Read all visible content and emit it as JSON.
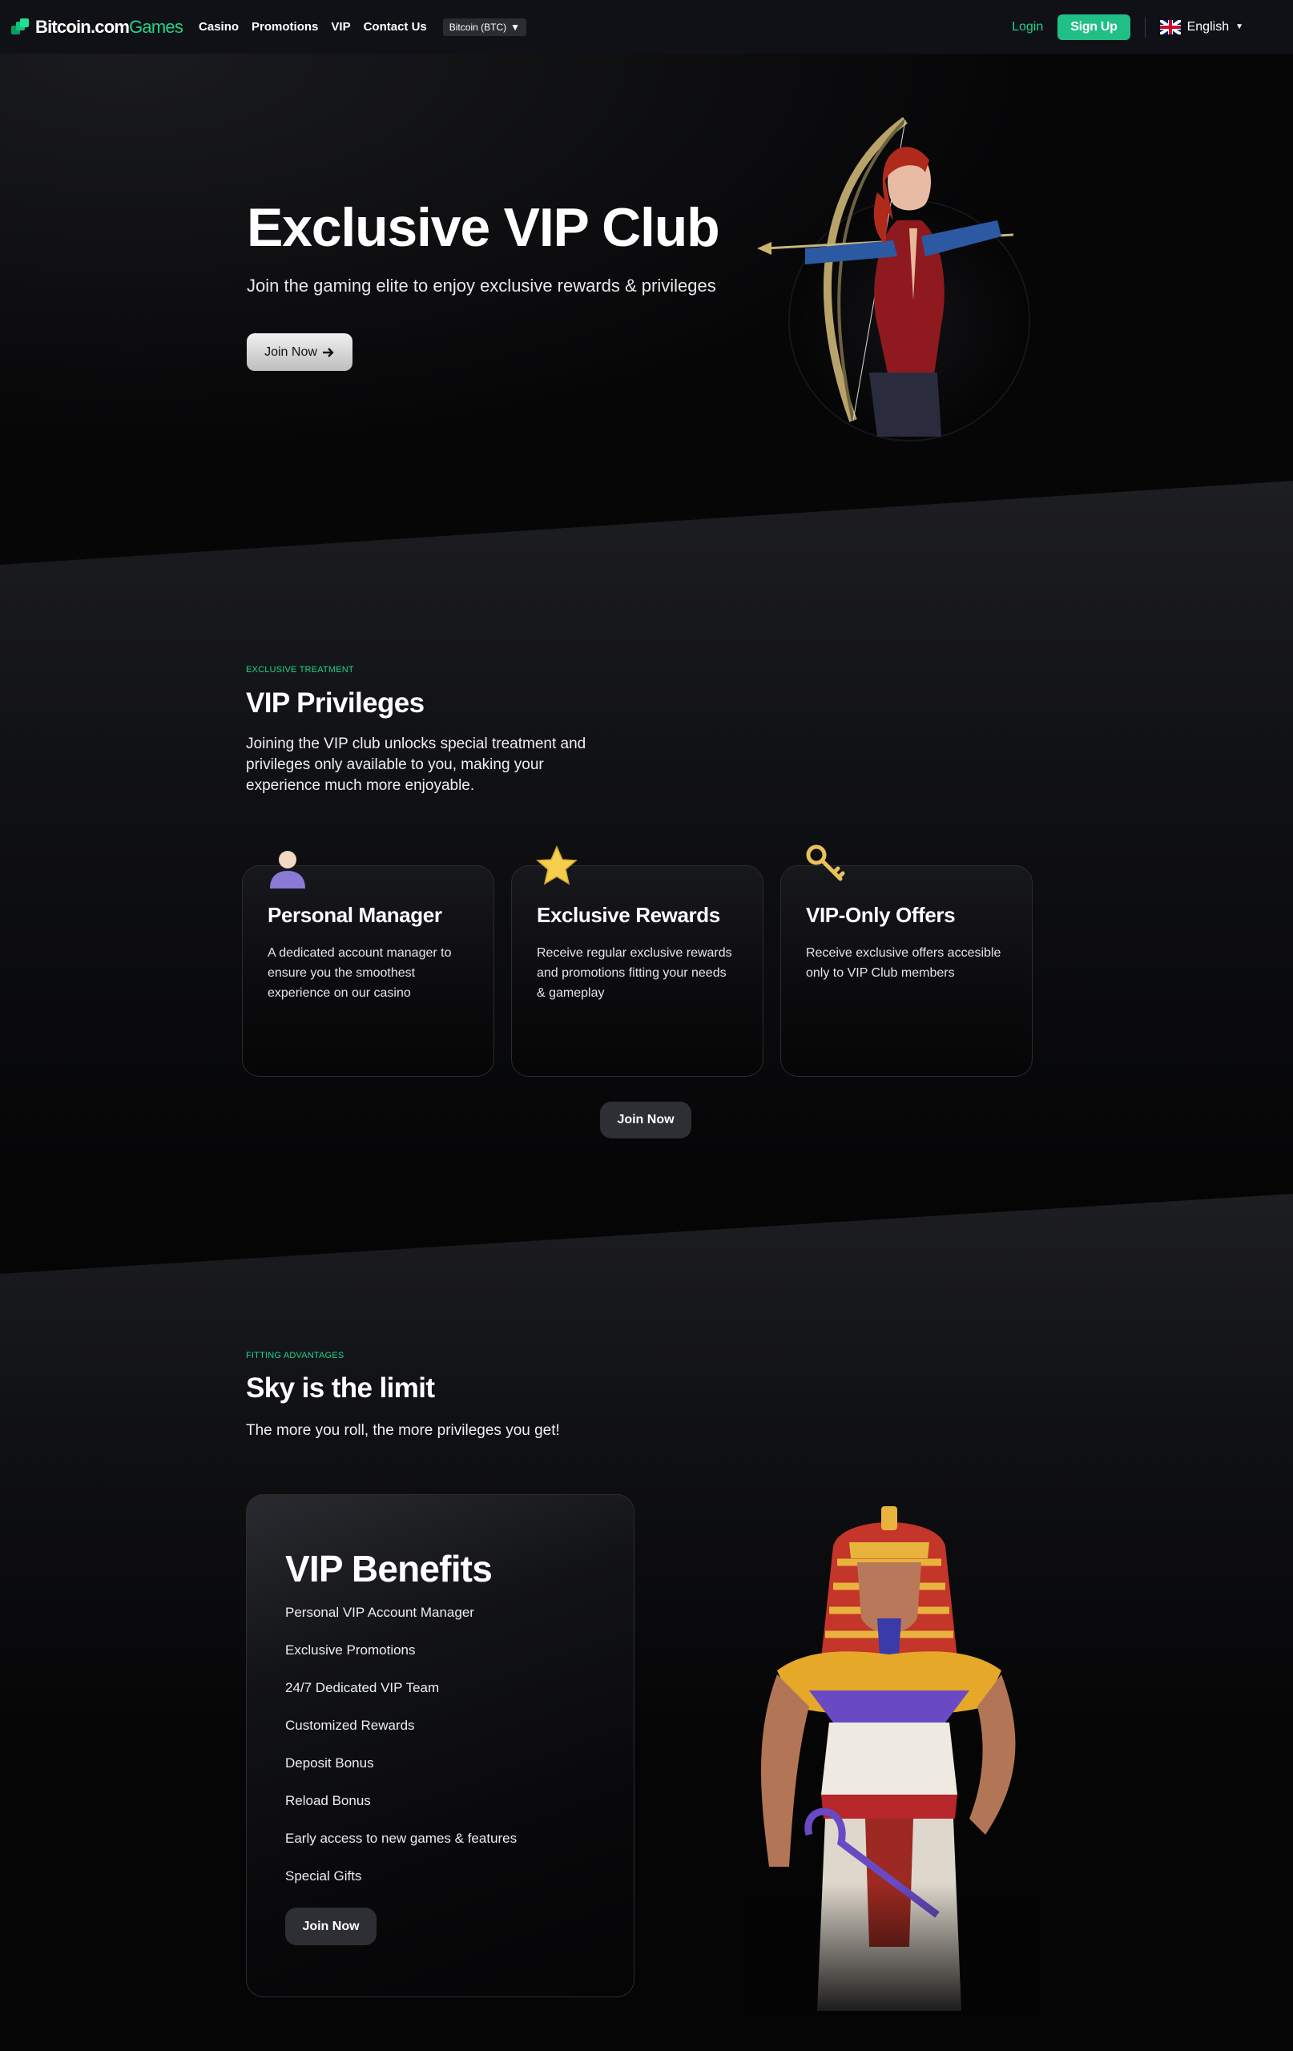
{
  "nav": {
    "logo_main": "Bitcoin.com",
    "logo_accent": "Games",
    "links": [
      "Casino",
      "Promotions",
      "VIP",
      "Contact Us"
    ],
    "currency": "Bitcoin (BTC)",
    "login": "Login",
    "signup": "Sign Up",
    "language": "English"
  },
  "hero": {
    "title": "Exclusive VIP Club",
    "subtitle": "Join the gaming elite to enjoy exclusive rewards & privileges",
    "button": "Join Now"
  },
  "privileges": {
    "eyebrow": "EXCLUSIVE TREATMENT",
    "title": "VIP Privileges",
    "text": "Joining the VIP club unlocks special treatment and privileges only available to you, making your experience much more enjoyable.",
    "cards": [
      {
        "title": "Personal Manager",
        "text": "A dedicated account manager to ensure you the smoothest experience on our casino",
        "icon": "person-icon"
      },
      {
        "title": "Exclusive Rewards",
        "text": "Receive regular exclusive rewards and promotions fitting your needs & gameplay",
        "icon": "star-icon"
      },
      {
        "title": "VIP-Only Offers",
        "text": "Receive exclusive offers accesible only to VIP Club members",
        "icon": "key-icon"
      }
    ],
    "button": "Join Now"
  },
  "advantages": {
    "eyebrow": "FITTING ADVANTAGES",
    "title": "Sky is the limit",
    "text": "The more you roll, the more privileges you get!",
    "benefits_title": "VIP Benefits",
    "benefits": [
      "Personal VIP Account Manager",
      "Exclusive Promotions",
      "24/7 Dedicated VIP Team",
      "Customized Rewards",
      "Deposit Bonus",
      "Reload Bonus",
      "Early access to new games & features",
      "Special Gifts"
    ],
    "button": "Join Now"
  },
  "colors": {
    "accent": "#1fd38a",
    "signup_bg": "#1fbf86",
    "nav_bg": "#0f1116",
    "page_bg": "#050506"
  }
}
